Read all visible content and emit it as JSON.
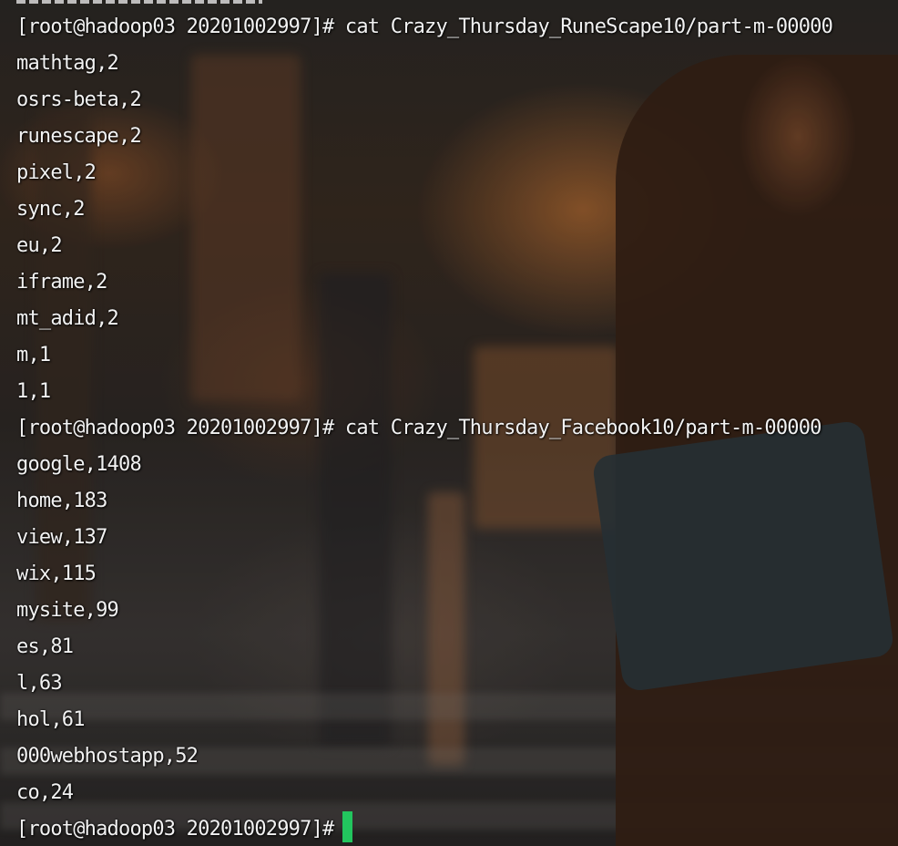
{
  "terminal": {
    "cursor_color": "#22c55e",
    "text_color": "#f2f2f2",
    "lines": [
      "[root@hadoop03 20201002997]# cat Crazy_Thursday_RuneScape10/part-m-00000",
      "mathtag,2",
      "osrs-beta,2",
      "runescape,2",
      "pixel,2",
      "sync,2",
      "eu,2",
      "iframe,2",
      "mt_adid,2",
      "m,1",
      "1,1",
      "[root@hadoop03 20201002997]# cat Crazy_Thursday_Facebook10/part-m-00000",
      "google,1408",
      "home,183",
      "view,137",
      "wix,115",
      "mysite,99",
      "es,81",
      "l,63",
      "hol,61",
      "000webhostapp,52",
      "co,24"
    ],
    "prompt": "[root@hadoop03 20201002997]#"
  }
}
